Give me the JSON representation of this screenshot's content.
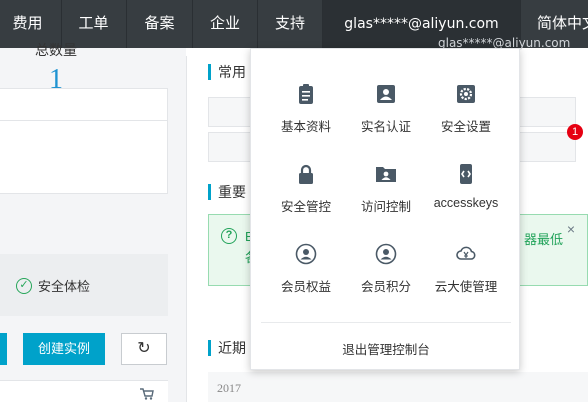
{
  "topnav": {
    "items": [
      "费用",
      "工单",
      "备案",
      "企业",
      "支持"
    ],
    "account": "glas*****@aliyun.com",
    "language": "简体中文"
  },
  "left": {
    "count_label": "总数量",
    "count_value": "1",
    "health_check": "安全体检",
    "create_instance": "创建实例"
  },
  "right": {
    "common_title": "常用",
    "important_title": "重要",
    "recent_title": "近期",
    "notice": {
      "line1": "E",
      "line2": "各",
      "line1_end": "器最低"
    },
    "year": "2017",
    "badge": "1",
    "ghost_user": "glas*****@aliyun.com"
  },
  "dropdown": {
    "items": [
      {
        "label": "基本资料",
        "icon": "clipboard-icon"
      },
      {
        "label": "实名认证",
        "icon": "id-card-icon"
      },
      {
        "label": "安全设置",
        "icon": "gear-icon"
      },
      {
        "label": "安全管控",
        "icon": "lock-icon"
      },
      {
        "label": "访问控制",
        "icon": "user-folder-icon"
      },
      {
        "label": "accesskeys",
        "icon": "key-phone-icon"
      },
      {
        "label": "会员权益",
        "icon": "member-icon"
      },
      {
        "label": "会员积分",
        "icon": "member-points-icon"
      },
      {
        "label": "云大使管理",
        "icon": "cloud-yen-icon"
      }
    ],
    "logout": "退出管理控制台"
  },
  "colors": {
    "topbar": "#373d41",
    "accent": "#00a2ca",
    "success": "#22a35a",
    "badge": "#e60012"
  }
}
